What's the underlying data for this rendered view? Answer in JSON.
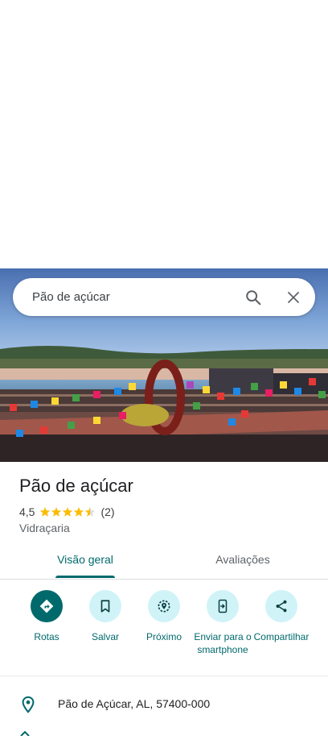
{
  "search": {
    "query": "Pão de açúcar"
  },
  "place": {
    "name": "Pão de açúcar",
    "rating": "4,5",
    "rating_value": 4.5,
    "review_count": "(2)",
    "category": "Vidraçaria"
  },
  "tabs": [
    {
      "label": "Visão geral",
      "active": true
    },
    {
      "label": "Avaliações",
      "active": false
    }
  ],
  "actions": [
    {
      "label": "Rotas",
      "icon": "directions-icon"
    },
    {
      "label": "Salvar",
      "icon": "bookmark-icon"
    },
    {
      "label": "Próximo",
      "icon": "nearby-icon"
    },
    {
      "label": "Enviar para o smartphone",
      "icon": "send-to-phone-icon"
    },
    {
      "label": "Compartilhar",
      "icon": "share-icon"
    }
  ],
  "address": "Pão de Açúcar, AL, 57400-000",
  "colors": {
    "accent": "#00696c",
    "star": "#fbbc04",
    "action_bg": "#d0f3f8"
  }
}
